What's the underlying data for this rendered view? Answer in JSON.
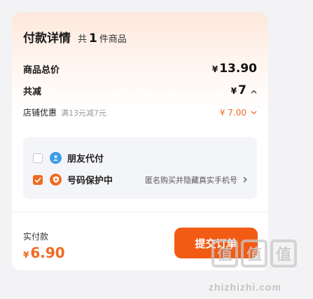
{
  "header": {
    "title": "付款详情",
    "count_prefix": "共",
    "count": "1",
    "count_suffix": "件商品"
  },
  "summary": {
    "goods_total_label": "商品总价",
    "currency": "¥",
    "goods_total_value": "13.90",
    "discount_total_label": "共减",
    "discount_total_value": "7",
    "store_discount_label": "店铺优惠",
    "store_discount_rule": "满13元减7元",
    "store_discount_value": "¥ 7.00"
  },
  "options": {
    "friend_pay_label": "朋友代付",
    "friend_pay_checked": false,
    "number_protect_label": "号码保护中",
    "number_protect_checked": true,
    "number_protect_hint": "匿名购买并隐藏真实手机号"
  },
  "footer": {
    "paid_label": "实付款",
    "currency": "¥",
    "paid_value": "6.90",
    "submit_label": "提交订单"
  },
  "watermark": {
    "logo_chars": [
      "值",
      "值",
      "值"
    ],
    "text": "zhizhizhi.com"
  },
  "colors": {
    "accent": "#f06a22",
    "button": "#f25b14",
    "friend_icon": "#3d9de8"
  }
}
